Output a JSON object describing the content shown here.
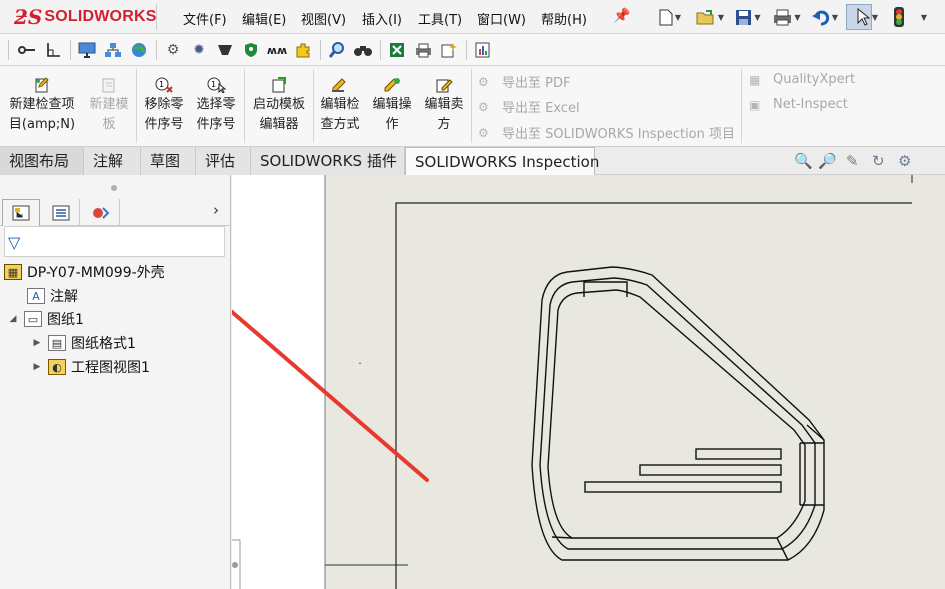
{
  "app": {
    "logo_mark": "ƻS",
    "logo_text": "SOLIDWORKS"
  },
  "menu": [
    "文件(F)",
    "编辑(E)",
    "视图(V)",
    "插入(I)",
    "工具(T)",
    "窗口(W)",
    "帮助(H)"
  ],
  "quick_access": [
    "new-document-icon",
    "open-icon",
    "save-icon",
    "print-icon",
    "undo-icon",
    "select-icon",
    "rebuild-light-icon"
  ],
  "commands": {
    "new_inspection": {
      "line1": "新建检查项",
      "line2": "目(amp;N)"
    },
    "new_template": {
      "line1": "新建模",
      "line2": "板"
    },
    "remove_balloon": {
      "line1": "移除零",
      "line2": "件序号"
    },
    "select_balloon": {
      "line1": "选择零",
      "line2": "件序号"
    },
    "template_editor": {
      "line1": "启动模板",
      "line2": "编辑器"
    },
    "edit_inspection": {
      "line1": "编辑检",
      "line2": "查方式"
    },
    "edit_operation": {
      "line1": "编辑操",
      "line2": "作"
    },
    "edit_vendor": {
      "line1": "编辑卖",
      "line2": "方"
    },
    "export_pdf": "导出至 PDF",
    "export_excel": "导出至 Excel",
    "export_project": "导出至 SOLIDWORKS Inspection 项目",
    "quality_xpert": "QualityXpert",
    "net_inspect": "Net-Inspect"
  },
  "tabs": [
    "视图布局",
    "注解",
    "草图",
    "评估",
    "SOLIDWORKS 插件",
    "SOLIDWORKS Inspection"
  ],
  "tree": {
    "root": "DP-Y07-MM099-外壳",
    "annotations": "注解",
    "sheet": "图纸1",
    "sheet_format": "图纸格式1",
    "drawing_view": "工程图视图1"
  },
  "colors": {
    "brand_red": "#d22030",
    "arrow_red": "#e8392f",
    "graphics_bg": "#e9e8e0"
  }
}
